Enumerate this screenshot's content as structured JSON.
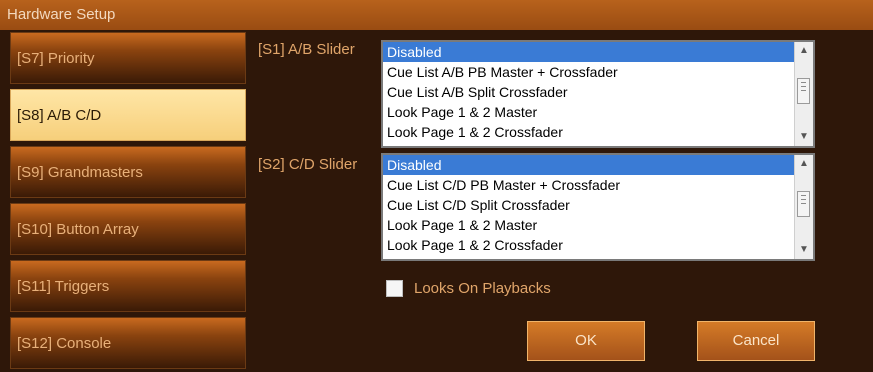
{
  "window": {
    "title": "Hardware Setup"
  },
  "sidebar": {
    "items": [
      {
        "label": "[S7] Priority"
      },
      {
        "label": "[S8] A/B C/D"
      },
      {
        "label": "[S9] Grandmasters"
      },
      {
        "label": "[S10] Button Array"
      },
      {
        "label": "[S11] Triggers"
      },
      {
        "label": "[S12] Console"
      }
    ],
    "active_index": 1
  },
  "s1": {
    "label": "[S1] A/B Slider",
    "options": [
      "Disabled",
      "Cue List A/B PB Master + Crossfader",
      "Cue List A/B Split Crossfader",
      "Look Page 1 & 2 Master",
      "Look Page 1 & 2 Crossfader"
    ],
    "selected": "Disabled"
  },
  "s2": {
    "label": "[S2] C/D Slider",
    "options": [
      "Disabled",
      "Cue List C/D PB Master + Crossfader",
      "Cue List C/D Split Crossfader",
      "Look Page 1 & 2 Master",
      "Look Page 1 & 2 Crossfader"
    ],
    "selected": "Disabled"
  },
  "looks_on_playbacks": {
    "label": "Looks On Playbacks",
    "checked": false
  },
  "buttons": {
    "ok": "OK",
    "cancel": "Cancel"
  },
  "colors": {
    "selection": "#3a7bd5",
    "accent": "#c96a1f",
    "active_tab": "#f6cf7b"
  }
}
